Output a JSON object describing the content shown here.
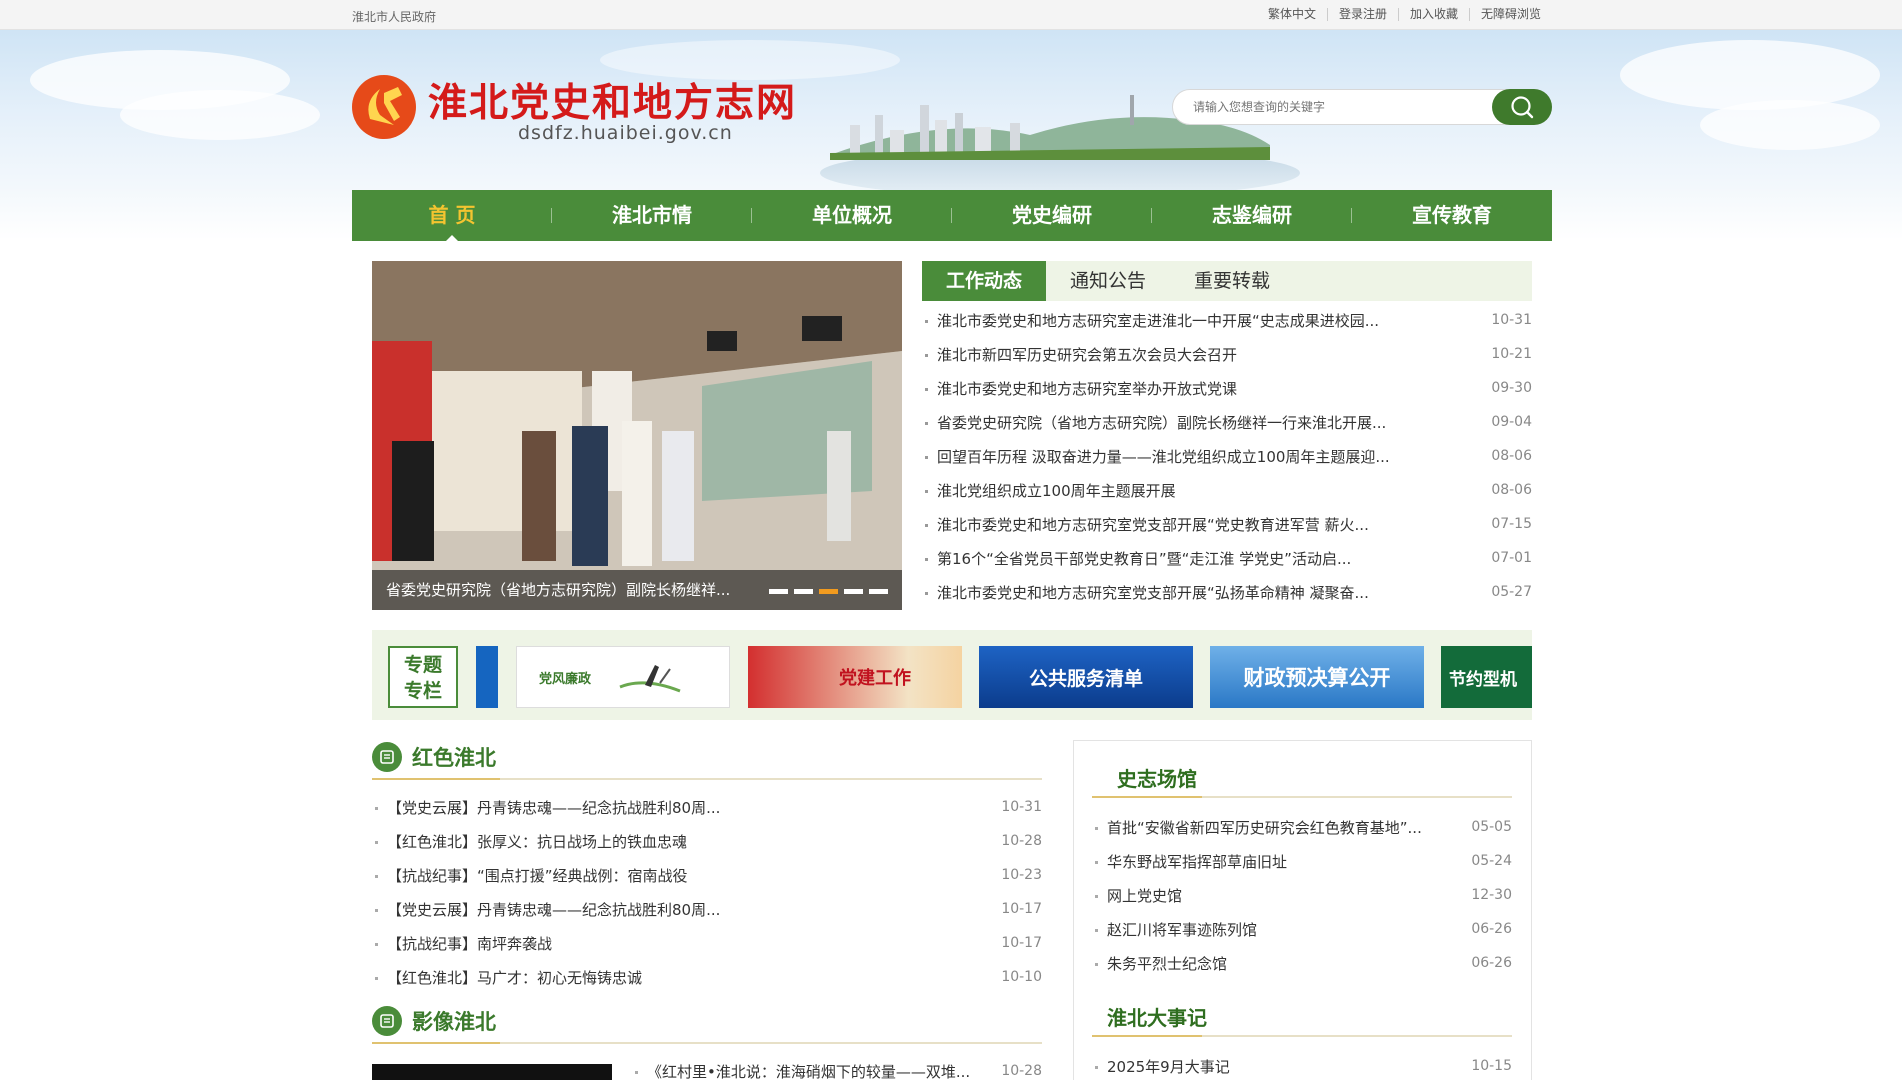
{
  "topbar": {
    "gov_link": "淮北市人民政府",
    "links": [
      "繁体中文",
      "登录注册",
      "加入收藏",
      "无障碍浏览"
    ]
  },
  "site": {
    "title": "淮北党史和地方志网",
    "url": "dsdfz.huaibei.gov.cn"
  },
  "search": {
    "placeholder": "请输入您想查询的关键字"
  },
  "nav": [
    "首 页",
    "淮北市情",
    "单位概况",
    "党史编研",
    "志鉴编研",
    "宣传教育"
  ],
  "carousel": {
    "caption": "省委党史研究院（省地方志研究院）副院长杨继祥...",
    "dot_count": 5,
    "active_dot": 3
  },
  "tabs": [
    "工作动态",
    "通知公告",
    "重要转载"
  ],
  "news": [
    {
      "title": "淮北市委党史和地方志研究室走进淮北一中开展“史志成果进校园...",
      "date": "10-31"
    },
    {
      "title": "淮北市新四军历史研究会第五次会员大会召开",
      "date": "10-21"
    },
    {
      "title": "淮北市委党史和地方志研究室举办开放式党课",
      "date": "09-30"
    },
    {
      "title": "省委党史研究院（省地方志研究院）副院长杨继祥一行来淮北开展...",
      "date": "09-04"
    },
    {
      "title": "回望百年历程 汲取奋进力量——淮北党组织成立100周年主题展迎...",
      "date": "08-06"
    },
    {
      "title": "淮北党组织成立100周年主题展开展",
      "date": "08-06"
    },
    {
      "title": "淮北市委党史和地方志研究室党支部开展“党史教育进军营 薪火...",
      "date": "07-15"
    },
    {
      "title": "第16个“全省党员干部党史教育日”暨“走江淮 学党史”活动启...",
      "date": "07-01"
    },
    {
      "title": "淮北市委党史和地方志研究室党支部开展“弘扬革命精神 凝聚奋...",
      "date": "05-27"
    }
  ],
  "special": {
    "line1": "专题",
    "line2": "专栏"
  },
  "banners": [
    "党风廉政",
    "党建工作",
    "公共服务清单",
    "财政预决算公开",
    "节约型机"
  ],
  "red": {
    "title": "红色淮北",
    "items": [
      {
        "title": "【党史云展】丹青铸忠魂——纪念抗战胜利80周...",
        "date": "10-31"
      },
      {
        "title": "【红色淮北】张厚义：抗日战场上的铁血忠魂",
        "date": "10-28"
      },
      {
        "title": "【抗战纪事】“围点打援”经典战例：宿南战役",
        "date": "10-23"
      },
      {
        "title": "【党史云展】丹青铸忠魂——纪念抗战胜利80周...",
        "date": "10-17"
      },
      {
        "title": "【抗战纪事】南坪奔袭战",
        "date": "10-17"
      },
      {
        "title": "【红色淮北】马广才：初心无悔铸忠诚",
        "date": "10-10"
      }
    ]
  },
  "video": {
    "title": "影像淮北",
    "items": [
      {
        "title": "《红村里•淮北说：淮海硝烟下的较量——双堆...",
        "date": "10-28"
      }
    ]
  },
  "venues": {
    "title": "史志场馆",
    "items": [
      {
        "title": "首批“安徽省新四军历史研究会红色教育基地”...",
        "date": "05-05"
      },
      {
        "title": "华东野战军指挥部草庙旧址",
        "date": "05-24"
      },
      {
        "title": "网上党史馆",
        "date": "12-30"
      },
      {
        "title": "赵汇川将军事迹陈列馆",
        "date": "06-26"
      },
      {
        "title": "朱务平烈士纪念馆",
        "date": "06-26"
      }
    ]
  },
  "events": {
    "title": "淮北大事记",
    "items": [
      {
        "title": "2025年9月大事记",
        "date": "10-15"
      }
    ]
  },
  "colors": {
    "primary_green": "#4a8c3a",
    "title_red": "#d41a1a",
    "active_nav": "#f4c430",
    "active_dot": "#f29b1f"
  }
}
